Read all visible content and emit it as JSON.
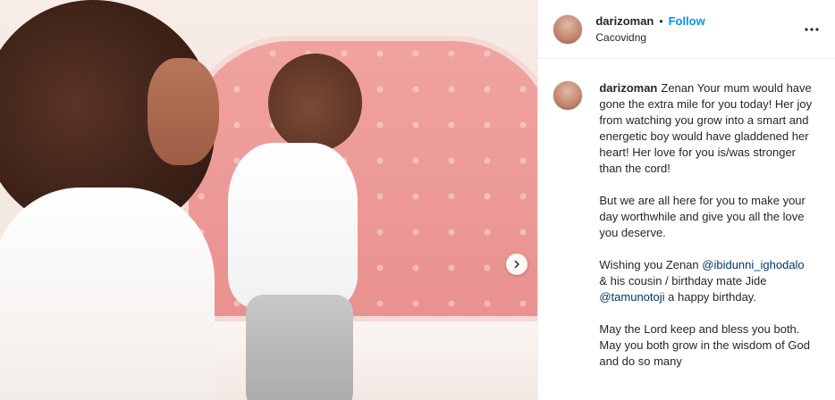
{
  "post": {
    "media": {
      "next_icon": "chevron-right-icon"
    },
    "header": {
      "username": "darizoman",
      "separator": "•",
      "follow_label": "Follow",
      "location": "Cacovidng",
      "more_icon": "more-horizontal-icon"
    },
    "caption": {
      "username": "darizoman",
      "p1": "Zenan Your mum would have gone the extra mile for you today! Her joy from watching you grow into a smart and energetic boy would have gladdened her heart! Her love for you is/was stronger than the cord!",
      "p2": "But we are all here for you to make your day worthwhile and give you all the love you deserve.",
      "p3_a": "Wishing you Zenan",
      "mention1": "@ibidunni_ighodalo",
      "p3_b": "& his cousin / birthday mate Jide",
      "mention2": "@tamunotoji",
      "p3_c": "a happy birthday.",
      "p4": "May the Lord keep and bless you both. May you both grow in the wisdom of God and do so many"
    }
  }
}
